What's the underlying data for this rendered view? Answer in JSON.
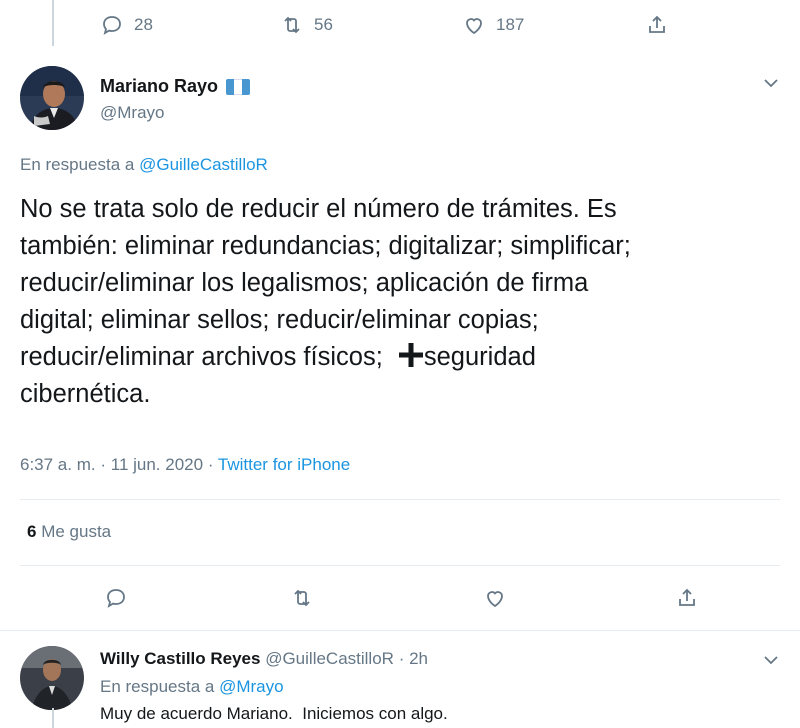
{
  "previous_tweet": {
    "reply_count": "28",
    "retweet_count": "56",
    "like_count": "187"
  },
  "main_tweet": {
    "display_name": "Mariano Rayo",
    "handle": "@Mrayo",
    "reply_prefix": "En respuesta a",
    "reply_to": "@GuilleCastilloR",
    "text_lines": [
      "No se trata solo de reducir el número de trámites. Es",
      "también: eliminar redundancias; digitalizar; simplificar;",
      "reducir/eliminar los legalismos; aplicación de firma",
      "digital; eliminar sellos; reducir/eliminar copias;",
      "reducir/eliminar archivos físicos;",
      "seguridad",
      "cibernética."
    ],
    "time": "6:37 a. m.",
    "date": "11 jun. 2020",
    "separator": "·",
    "source": "Twitter for iPhone",
    "likes_count": "6",
    "likes_label": "Me gusta"
  },
  "reply_tweet": {
    "display_name": "Willy Castillo Reyes",
    "handle": "@GuilleCastilloR",
    "age": "2h",
    "reply_prefix": "En respuesta a",
    "reply_to": "@Mrayo",
    "text": "Muy de acuerdo Mariano.  Iniciemos con algo."
  },
  "colors": {
    "accent": "#1b95e0",
    "muted": "#657786",
    "divider": "#e6ecf0"
  }
}
